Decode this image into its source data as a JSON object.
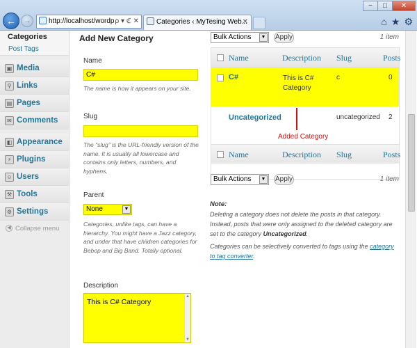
{
  "browser": {
    "address": "http://localhost/wordpres",
    "address_tools": "ρ ▾ ℭ ✕",
    "tab_title": "Categories ‹ MyTesing Web...",
    "tab_close": "✕",
    "min": "−",
    "max": "□",
    "close": "✕",
    "home_icon": "⌂",
    "star_icon": "★",
    "gear_icon": "⚙"
  },
  "sidebar": {
    "sub_heading": "Categories",
    "sub_item": "Post Tags",
    "items": [
      {
        "label": "Media",
        "icon": "media-icon"
      },
      {
        "label": "Links",
        "icon": "links-icon"
      },
      {
        "label": "Pages",
        "icon": "pages-icon"
      },
      {
        "label": "Comments",
        "icon": "comments-icon"
      }
    ],
    "items2": [
      {
        "label": "Appearance",
        "icon": "appearance-icon"
      },
      {
        "label": "Plugins",
        "icon": "plugins-icon"
      },
      {
        "label": "Users",
        "icon": "users-icon"
      },
      {
        "label": "Tools",
        "icon": "tools-icon"
      },
      {
        "label": "Settings",
        "icon": "settings-icon"
      }
    ],
    "collapse": "Collapse menu"
  },
  "form": {
    "title": "Add New Category",
    "name_label": "Name",
    "name_value": "C#",
    "name_help": "The name is how it appears on your site.",
    "slug_label": "Slug",
    "slug_value": "",
    "slug_help": "The “slug” is the URL-friendly version of the name. It is usually all lowercase and contains only letters, numbers, and hyphens.",
    "parent_label": "Parent",
    "parent_value": "None",
    "parent_help": "Categories, unlike tags, can have a hierarchy. You might have a Jazz category, and under that have children categories for Bebop and Big Band. Totally optional.",
    "description_label": "Description",
    "description_value": "This is C# Category"
  },
  "list": {
    "bulk_actions": "Bulk Actions",
    "apply": "Apply",
    "count": "1 item",
    "columns": [
      "Name",
      "Description",
      "Slug",
      "Posts"
    ],
    "rows": [
      {
        "name": "C#",
        "description": "This is C# Category",
        "slug": "c",
        "posts": "0"
      },
      {
        "name": "Uncategorized",
        "description": "",
        "slug": "uncategorized",
        "posts": "2"
      }
    ],
    "annotation": "Added Category"
  },
  "note": {
    "heading": "Note:",
    "text1": "Deleting a category does not delete the posts in that category. Instead, posts that were only assigned to the deleted category are set to the category",
    "text1_bold": "Uncategorized",
    "text2": "Categories can be selectively converted to tags using the",
    "link": "category to tag converter"
  },
  "colors": {
    "highlight": "#ffff00",
    "link": "#21759b",
    "annotation": "#cc1111"
  }
}
